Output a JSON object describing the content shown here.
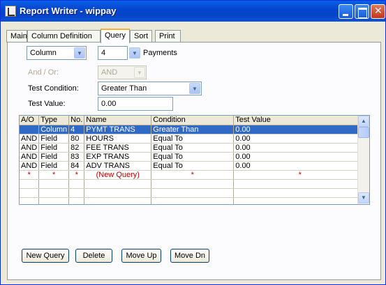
{
  "window": {
    "title": "Report Writer - wippay"
  },
  "tabs": [
    {
      "label": "Main"
    },
    {
      "label": "Column Definition"
    },
    {
      "label": "Query",
      "active": true
    },
    {
      "label": "Sort"
    },
    {
      "label": "Print"
    }
  ],
  "query": {
    "target_type": "Column",
    "target_number": "4",
    "target_name": "Payments",
    "and_or_label": "And / Or:",
    "and_or_value": "AND",
    "test_condition_label": "Test Condition:",
    "test_condition_value": "Greater Than",
    "test_value_label": "Test Value:",
    "test_value_value": "0.00"
  },
  "grid": {
    "columns": [
      "A/O",
      "Type",
      "No.",
      "Name",
      "Condition",
      "Test Value"
    ],
    "rows": [
      {
        "ao": "",
        "type": "Column",
        "no": "4",
        "name": "PYMT TRANS",
        "condition": "Greater Than",
        "test_value": "0.00",
        "selected": true
      },
      {
        "ao": "AND",
        "type": "Field",
        "no": "80",
        "name": "HOURS",
        "condition": "Equal To",
        "test_value": "0.00"
      },
      {
        "ao": "AND",
        "type": "Field",
        "no": "82",
        "name": "FEE TRANS",
        "condition": "Equal To",
        "test_value": "0.00"
      },
      {
        "ao": "AND",
        "type": "Field",
        "no": "83",
        "name": "EXP TRANS",
        "condition": "Equal To",
        "test_value": "0.00"
      },
      {
        "ao": "AND",
        "type": "Field",
        "no": "84",
        "name": "ADV TRANS",
        "condition": "Equal To",
        "test_value": "0.00"
      }
    ],
    "new_row": {
      "marker": "*",
      "name": "(New Query)"
    }
  },
  "buttons": {
    "new_query": "New Query",
    "delete": "Delete",
    "move_up": "Move Up",
    "move_dn": "Move Dn"
  },
  "icons": {
    "app": "report-writer-icon",
    "minimize": "minimize-icon",
    "maximize": "maximize-icon",
    "close": "close-icon"
  },
  "colors": {
    "titlebar": "#0a5fe8",
    "selected_row": "#316ac5",
    "new_row_text": "#c00000",
    "active_tab_accent": "#f1b433"
  }
}
